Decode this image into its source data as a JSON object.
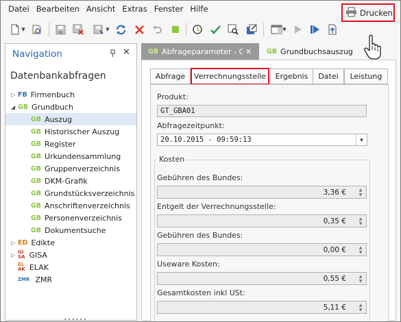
{
  "menu": {
    "items": [
      "Datei",
      "Bearbeiten",
      "Ansicht",
      "Extras",
      "Fenster",
      "Hilfe"
    ]
  },
  "toolbar": {
    "print_label": "Drucken"
  },
  "navigation": {
    "title": "Navigation",
    "pin": "ᵖ",
    "close": "✕",
    "subtitle": "Datenbankabfragen",
    "items": [
      {
        "badge": "FB",
        "label": "Firmenbuch"
      },
      {
        "badge": "GB",
        "label": "Grundbuch"
      },
      {
        "badge": "GB",
        "label": "Auszug"
      },
      {
        "badge": "GB",
        "label": "Historischer Auszug"
      },
      {
        "badge": "GB",
        "label": "Register"
      },
      {
        "badge": "GB",
        "label": "Urkundensammlung"
      },
      {
        "badge": "GB",
        "label": "Gruppenverzeichnis"
      },
      {
        "badge": "GB",
        "label": "DKM-Grafik"
      },
      {
        "badge": "GB",
        "label": "Grundstücksverzeichnis"
      },
      {
        "badge": "GB",
        "label": "Anschriftenverzeichnis"
      },
      {
        "badge": "GB",
        "label": "Personenverzeichnis"
      },
      {
        "badge": "GB",
        "label": "Dokumentsuche"
      },
      {
        "badge": "ED",
        "label": "Edikte"
      },
      {
        "badge_top": "GI",
        "badge_bottom": "SA",
        "label": "GISA"
      },
      {
        "badge_top": "EL",
        "badge_bottom": "AK",
        "label": "ELAK"
      },
      {
        "badge": "ZMR",
        "label": "ZMR"
      }
    ]
  },
  "doc_tabs": [
    {
      "badge": "GB",
      "label": "Abfrageparameter - Gru",
      "close": "✕"
    },
    {
      "badge": "GB",
      "label": "Grundbuchsauszug"
    }
  ],
  "inner_tabs": [
    "Abfrage",
    "Verrechnungsstelle",
    "Ergebnis",
    "Datei",
    "Leistung"
  ],
  "form": {
    "produkt_label": "Produkt:",
    "produkt_value": "GT_GBA01",
    "zeitpunkt_label": "Abfragezeitpunkt:",
    "zeitpunkt_value": "20.10.2015 - 09:59:13",
    "kosten_legend": "Kosten",
    "kosten": [
      {
        "label": "Gebühren des Bundes:",
        "value": "3,36 €"
      },
      {
        "label": "Entgelt der Verrechnungsstelle:",
        "value": "0,35 €"
      },
      {
        "label": "Gebühren des Bundes:",
        "value": "0,00 €"
      },
      {
        "label": "Useware Kosten:",
        "value": "0,55 €"
      },
      {
        "label": "Gesamtkosten inkl USt:",
        "value": "5,11 €"
      }
    ]
  },
  "colors": {
    "gb_green": "#8cc63f",
    "fb_blue": "#3a6fb0",
    "ed_orange": "#e07b00",
    "red_highlight": "#d11122",
    "nav_title_blue": "#2867b3",
    "active_tab_gray": "#9a9a9a"
  }
}
